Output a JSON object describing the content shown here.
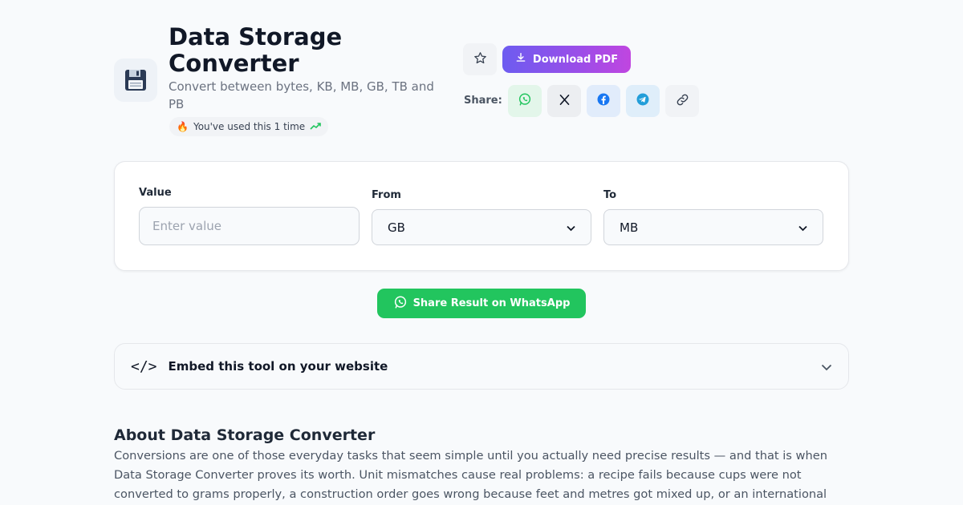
{
  "header": {
    "title": "Data Storage Converter",
    "subtitle": "Convert between bytes, KB, MB, GB, TB and PB",
    "usage_badge": "You've used this 1 time",
    "icon": "floppy-disk-icon"
  },
  "actions": {
    "download_label": "Download PDF",
    "share_label": "Share:"
  },
  "converter": {
    "value_label": "Value",
    "value_placeholder": "Enter value",
    "value": "",
    "from_label": "From",
    "from_value": "GB",
    "to_label": "To",
    "to_value": "MB"
  },
  "share_result_label": "Share Result on WhatsApp",
  "embed": {
    "label": "Embed this tool on your website",
    "glyph": "</>"
  },
  "about": {
    "title": "About Data Storage Converter",
    "body": "Conversions are one of those everyday tasks that seem simple until you actually need precise results — and that is when Data Storage Converter proves its worth. Unit mismatches cause real problems: a recipe fails because cups were not converted to grams properly, a construction order goes wrong because feet and metres got mixed up, or an international"
  },
  "colors": {
    "accent_start": "#6d5cf0",
    "accent_end": "#c046e0",
    "whatsapp": "#22c55e",
    "facebook": "#1877f2",
    "telegram": "#229ed9"
  }
}
